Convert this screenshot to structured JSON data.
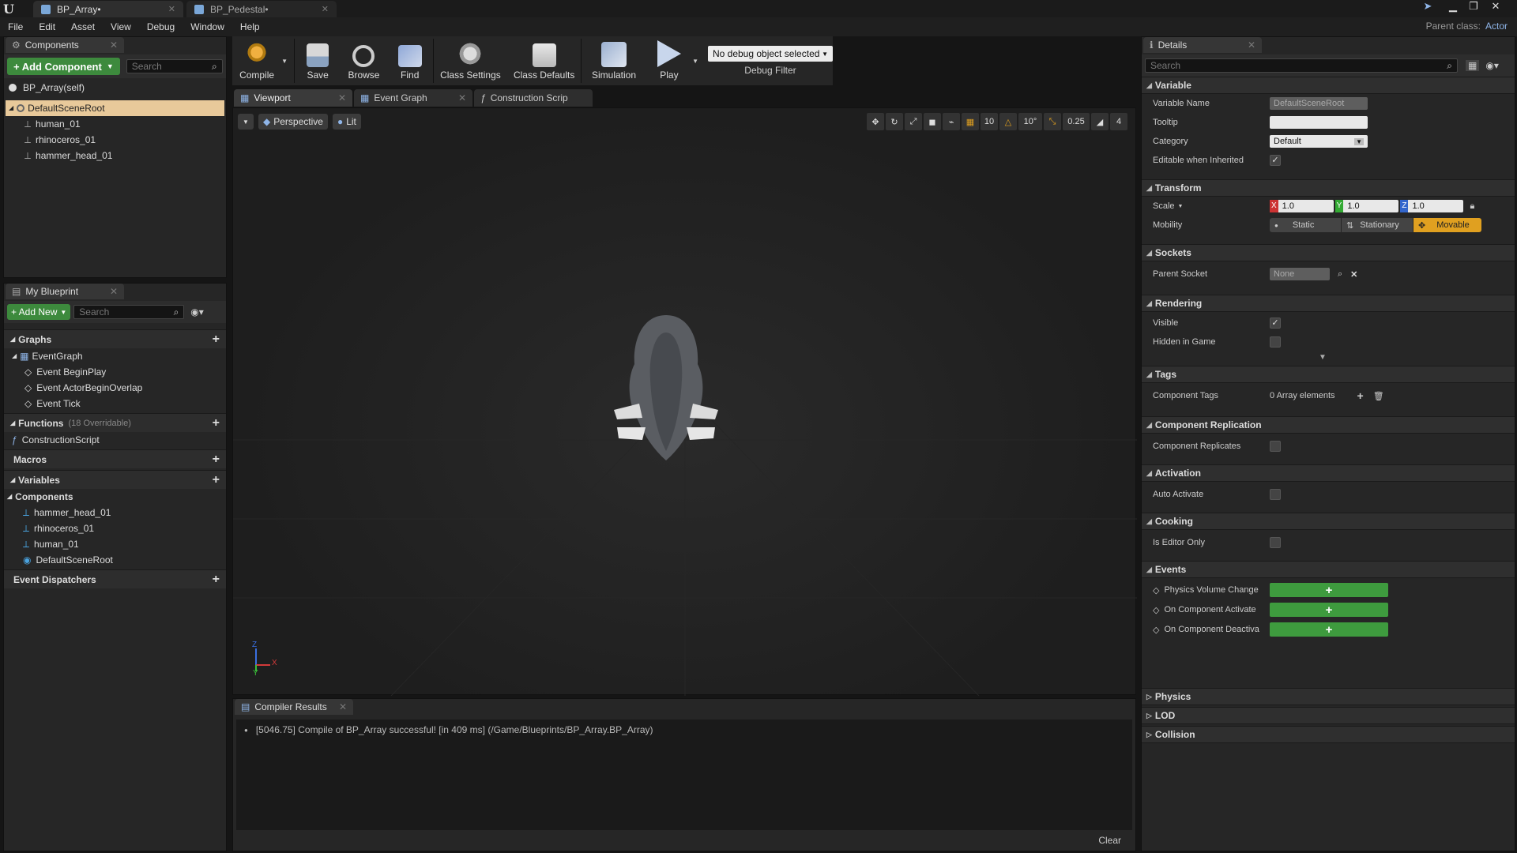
{
  "tabs": [
    {
      "label": "BP_Array•"
    },
    {
      "label": "BP_Pedestal•"
    }
  ],
  "menu": [
    "File",
    "Edit",
    "Asset",
    "View",
    "Debug",
    "Window",
    "Help"
  ],
  "parent_class": {
    "label": "Parent class:",
    "value": "Actor"
  },
  "components_panel": {
    "tab_label": "Components",
    "add_button": "+ Add Component",
    "search_placeholder": "Search",
    "self_label": "BP_Array(self)",
    "root": "DefaultSceneRoot",
    "children": [
      "human_01",
      "rhinoceros_01",
      "hammer_head_01"
    ]
  },
  "my_blueprint": {
    "tab_label": "My Blueprint",
    "add_new": "+ Add New",
    "search_placeholder": "Search",
    "graphs_label": "Graphs",
    "event_graph": "EventGraph",
    "events": [
      "Event BeginPlay",
      "Event ActorBeginOverlap",
      "Event Tick"
    ],
    "functions_label": "Functions",
    "functions_note": "(18 Overridable)",
    "construction_script": "ConstructionScript",
    "macros_label": "Macros",
    "variables_label": "Variables",
    "components_label": "Components",
    "component_vars": [
      "hammer_head_01",
      "rhinoceros_01",
      "human_01",
      "DefaultSceneRoot"
    ],
    "dispatchers_label": "Event Dispatchers"
  },
  "toolbar": {
    "compile": "Compile",
    "save": "Save",
    "browse": "Browse",
    "find": "Find",
    "class_settings": "Class Settings",
    "class_defaults": "Class Defaults",
    "simulation": "Simulation",
    "play": "Play",
    "debug_select": "No debug object selected",
    "debug_filter": "Debug Filter"
  },
  "editor_tabs": [
    "Viewport",
    "Event Graph",
    "Construction Scrip"
  ],
  "viewport": {
    "perspective": "Perspective",
    "lit": "Lit",
    "grid_snap": "10",
    "rot_snap": "10°",
    "scale_snap": "0.25",
    "cam_speed": "4",
    "axis_z": "Z",
    "axis_x": "X",
    "axis_y": "Y"
  },
  "compiler": {
    "tab_label": "Compiler Results",
    "message": "[5046.75] Compile of BP_Array successful! [in 409 ms] (/Game/Blueprints/BP_Array.BP_Array)",
    "clear": "Clear"
  },
  "details": {
    "tab_label": "Details",
    "search_placeholder": "Search",
    "variable": {
      "title": "Variable",
      "name_label": "Variable Name",
      "name_value": "DefaultSceneRoot",
      "tooltip_label": "Tooltip",
      "category_label": "Category",
      "category_value": "Default",
      "editable_label": "Editable when Inherited"
    },
    "transform": {
      "title": "Transform",
      "scale_label": "Scale",
      "x": "1.0",
      "y": "1.0",
      "z": "1.0",
      "x_label": "X",
      "y_label": "Y",
      "z_label": "Z",
      "mobility_label": "Mobility",
      "static": "Static",
      "stationary": "Stationary",
      "movable": "Movable"
    },
    "sockets": {
      "title": "Sockets",
      "parent_label": "Parent Socket",
      "parent_value": "None"
    },
    "rendering": {
      "title": "Rendering",
      "visible": "Visible",
      "hidden": "Hidden in Game"
    },
    "tags": {
      "title": "Tags",
      "label": "Component Tags",
      "value": "0 Array elements"
    },
    "replication": {
      "title": "Component Replication",
      "label": "Component Replicates"
    },
    "activation": {
      "title": "Activation",
      "label": "Auto Activate"
    },
    "cooking": {
      "title": "Cooking",
      "label": "Is Editor Only"
    },
    "events": {
      "title": "Events",
      "items": [
        "Physics Volume Change",
        "On Component Activate",
        "On Component Deactiva"
      ]
    },
    "collapsed": [
      "Physics",
      "LOD",
      "Collision"
    ]
  },
  "colors": {
    "accent_green": "#3e9b3e",
    "movable_orange": "#e0a020",
    "selection": "#e8c99a"
  }
}
